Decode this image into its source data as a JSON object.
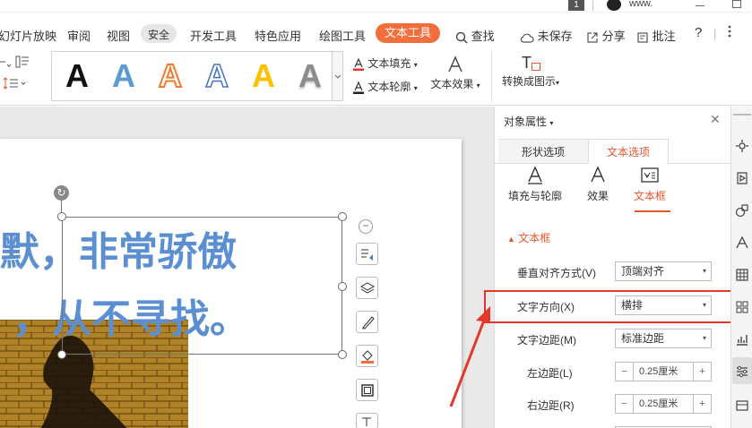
{
  "titlebar": {
    "badge": "1",
    "user": "www."
  },
  "menu": {
    "items": [
      {
        "label": "幻灯片放映"
      },
      {
        "label": "审阅"
      },
      {
        "label": "视图"
      },
      {
        "label": "安全"
      },
      {
        "label": "开发工具"
      },
      {
        "label": "特色应用"
      },
      {
        "label": "绘图工具"
      },
      {
        "label": "文本工具"
      }
    ],
    "search": "查找",
    "save": "未保存",
    "share": "分享",
    "comment": "批注",
    "help": "?"
  },
  "ribbon": {
    "gallery_letter": "A",
    "text_fill": "文本填充",
    "text_outline": "文本轮廓",
    "text_effect": "文本效果",
    "convert": "转换成图示",
    "convert_icon_letter": "T"
  },
  "slide": {
    "line1": "默，非常骄傲",
    "line2": "，从不寻找。"
  },
  "pane": {
    "title": "对象属性",
    "tabs": [
      "形状选项",
      "文本选项"
    ],
    "sub_tabs": [
      "填充与轮廓",
      "效果",
      "文本框"
    ],
    "section": "文本框",
    "rows": [
      {
        "label": "垂直对齐方式(V)",
        "value": "顶端对齐"
      },
      {
        "label": "文字方向(X)",
        "value": "横排"
      },
      {
        "label": "文字边距(M)",
        "value": "标准边距"
      },
      {
        "label": "左边距(L)",
        "value": "0.25厘米"
      },
      {
        "label": "右边距(R)",
        "value": "0.25厘米"
      }
    ]
  },
  "colors": {
    "accent": "#f26e3c",
    "slide_text": "#5b8fd1",
    "highlight_box": "#e5362a"
  }
}
